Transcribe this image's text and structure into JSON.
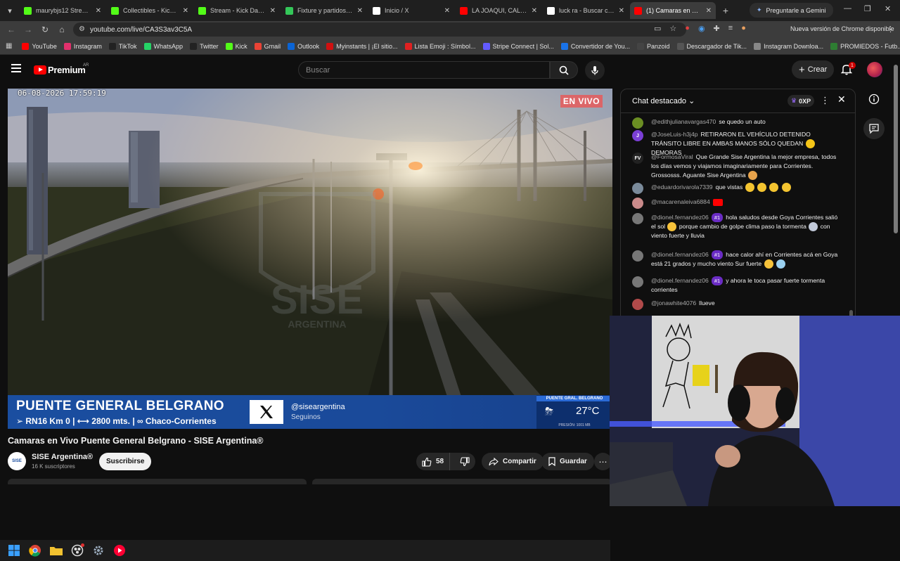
{
  "browser": {
    "tabs": [
      {
        "label": "maurybjs12 Stream -",
        "icon": "kick-icon",
        "color": "#53fc18"
      },
      {
        "label": "Collectibles - Kick Str",
        "icon": "kick-icon",
        "color": "#53fc18"
      },
      {
        "label": "Stream - Kick Dashbo",
        "icon": "kick-icon",
        "color": "#53fc18"
      },
      {
        "label": "Fixture y partidos de",
        "icon": "soccer-icon",
        "color": "#34c759"
      },
      {
        "label": "Inicio / X",
        "icon": "x-icon",
        "color": "#ffffff"
      },
      {
        "label": "LA JOAQUI, CALLEJE",
        "icon": "youtube-icon",
        "color": "#ff0000"
      },
      {
        "label": "luck ra - Buscar con G",
        "icon": "google-icon",
        "color": "#ffffff"
      },
      {
        "label": "(1) Camaras en Vivo",
        "icon": "youtube-icon",
        "color": "#ff0000",
        "active": true
      }
    ],
    "gemini_label": "Preguntarle a Gemini",
    "url": "youtube.com/live/CA3S3av3C5A",
    "update_label": "Nueva versión de Chrome disponible",
    "bookmarks": [
      {
        "label": "YouTube",
        "color": "#ff0000"
      },
      {
        "label": "Instagram",
        "color": "#e1306c"
      },
      {
        "label": "TikTok",
        "color": "#222222"
      },
      {
        "label": "WhatsApp",
        "color": "#25d366"
      },
      {
        "label": "Twitter",
        "color": "#222222"
      },
      {
        "label": "Kick",
        "color": "#53fc18"
      },
      {
        "label": "Gmail",
        "color": "#ea4335"
      },
      {
        "label": "Outlook",
        "color": "#0a64d6"
      },
      {
        "label": "Myinstants | ¡El sitio...",
        "color": "#d01010"
      },
      {
        "label": "Lista Emoji : Símbol...",
        "color": "#e02020"
      },
      {
        "label": "Stripe Connect | Sol...",
        "color": "#635bff"
      },
      {
        "label": "Convertidor de You...",
        "color": "#1a73e8"
      },
      {
        "label": "Panzoid",
        "color": "#444444"
      },
      {
        "label": "Descargador de Tik...",
        "color": "#555555"
      },
      {
        "label": "Instagram Downloa...",
        "color": "#888888"
      },
      {
        "label": "PROMIEDOS - Futb...",
        "color": "#2e7d32"
      }
    ]
  },
  "youtube": {
    "brand": "Premium",
    "country": "AR",
    "search_placeholder": "Buscar",
    "create_label": "Crear",
    "notif_count": "1",
    "video": {
      "timestamp": "06-08-2026 17:59:19",
      "live_label": "EN VIVO",
      "watermark": "SISE",
      "watermark_sub": "ARGENTINA",
      "lower_title": "PUENTE GENERAL BELGRANO",
      "lower_sub": "➢ RN16 Km 0 | ⟷ 2800 mts. | ∞ Chaco-Corrientes",
      "handle": "@siseargentina",
      "follow": "Seguinos",
      "weather_title": "PUENTE GRAL. BELGRANO",
      "temperature": "27°C",
      "pressure": "PRESIÓN: 1001 MB"
    },
    "title": "Camaras en Vivo Puente General Belgrano - SISE Argentina®",
    "channel": {
      "name": "SISE Argentina®",
      "subs": "16 K suscriptores",
      "subscribe": "Suscribirse",
      "avatar_text": "SISE"
    },
    "actions": {
      "likes": "58",
      "share": "Compartir",
      "save": "Guardar"
    },
    "chat": {
      "title": "Chat destacado",
      "xp": "0XP",
      "messages": [
        {
          "author": "@edithjulianavargas470",
          "text": "se quedo un auto",
          "color": "#6b8e23",
          "initial": ""
        },
        {
          "author": "@JoseLuis-h3j4p",
          "text": "RETIRARON EL VEHÍCULO DETENIDO TRÁNSITO LIBRE EN AMBAS MANOS SÓLO QUEDAN",
          "text2": "DEMORAS",
          "color": "#7b3fd6",
          "initial": "J"
        },
        {
          "author": "@FormosaViral",
          "text": "Que Grande Sise Argentina la mejor empresa, todos los días vemos y viajamos imaginariamente para Corrientes. Grossosss. Aguante Sise Argentina",
          "color": "#222222",
          "initial": "FV"
        },
        {
          "author": "@eduardorivarola7339",
          "text": "que vistas",
          "color": "#7a8a9a",
          "initial": ""
        },
        {
          "author": "@macarenaleiva6884",
          "text": "",
          "color": "#c98a8a",
          "initial": ""
        },
        {
          "author": "@dionel.fernandez06",
          "badge": "#1",
          "text": "hola saludos desde Goya Corrientes salió el sol",
          "text2": "porque cambio de golpe clima paso la tormenta",
          "text3": "con viento fuerte y lluvia",
          "color": "#777777",
          "initial": ""
        },
        {
          "author": "@dionel.fernandez06",
          "badge": "#1",
          "text": "hace calor ahí en Corrientes acá en Goya está 21 grados y mucho viento Sur fuerte",
          "color": "#777777",
          "initial": ""
        },
        {
          "author": "@dionel.fernandez06",
          "badge": "#1",
          "text": "y ahora le toca pasar fuerte tormenta corrientes",
          "color": "#777777",
          "initial": ""
        },
        {
          "author": "@jonawhite4076",
          "text": "llueve",
          "color": "#b04a4a",
          "initial": ""
        }
      ]
    }
  }
}
